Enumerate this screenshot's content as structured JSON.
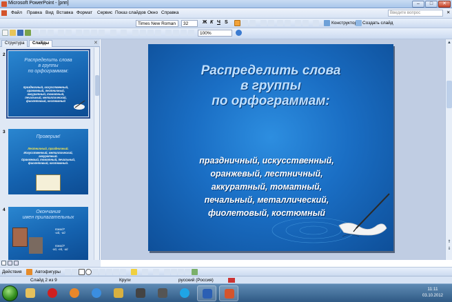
{
  "window": {
    "title": "Microsoft PowerPoint - [рпп]"
  },
  "menu": {
    "items": [
      "Файл",
      "Правка",
      "Вид",
      "Вставка",
      "Формат",
      "Сервис",
      "Показ слайдов",
      "Окно",
      "Справка"
    ],
    "help_placeholder": "Введите вопрос"
  },
  "toolbar": {
    "font_name": "Times New Roman",
    "font_size": "32",
    "bold": "Ж",
    "italic": "К",
    "underline": "Ч",
    "shadow": "S",
    "designer_label": "Конструктор",
    "new_slide_label": "Создать слайд",
    "zoom": "100%"
  },
  "panel": {
    "tabs": [
      "Структура",
      "Слайды"
    ],
    "active_tab": "Слайды",
    "slides": [
      {
        "number": "2",
        "title": "Распределить слова\nв группы\nпо орфограммам:",
        "body": "праздничный, искусственный,\nоранжевый, лестничный,\nаккуратный, томатный,\nпечальный, металлический,\nфиолетовый, костюмный"
      },
      {
        "number": "3",
        "title": "Проверим!",
        "body_yellow": "Лестничный, праздничный.",
        "body": "Искусственный, металлический,\nаккуратный.\nОранжевый, томатный, печальный,\nфиолетовый, костюмный."
      },
      {
        "number": "4",
        "title": "Окончания\nимен прилагательных",
        "q1": "Какой?\n-ый, -ий",
        "q2": "Какой?\n-ой, -ей, -ий"
      }
    ]
  },
  "slide": {
    "title": "Распределить слова\nв группы\nпо орфограммам:",
    "body": "праздничный, искусственный,\nоранжевый, лестничный,\nаккуратный, томатный,\nпечальный, металлический,\nфиолетовый, костюмный"
  },
  "drawbar": {
    "actions_label": "Действия",
    "autoshapes_label": "Автофигуры"
  },
  "status": {
    "slide_counter": "Слайд 2 из 9",
    "design": "Круги",
    "language": "русский (Россия)"
  },
  "taskbar": {
    "time": "11:11",
    "date": "03.10.2012"
  },
  "colors": {
    "slide_bg": "#1a6ec4",
    "slide_title": "#bfe0ff",
    "highlight_yellow": "#ffe94a"
  }
}
